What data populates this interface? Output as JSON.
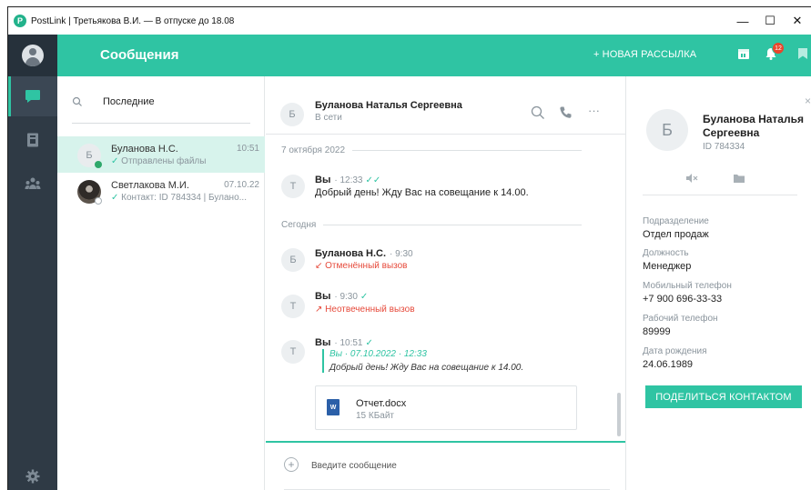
{
  "window": {
    "title": "PostLink  |  Третьякова В.И.  —  В отпуске до 18.08",
    "app_logo": "P",
    "minimize": "—",
    "maximize": "☐",
    "close": "✕"
  },
  "header": {
    "title": "Сообщения",
    "new_mailing": "+ НОВАЯ РАССЫЛКА",
    "notifications_count": "12"
  },
  "search": {
    "label": "Последние"
  },
  "chats": [
    {
      "initial": "Б",
      "name": "Буланова Н.С.",
      "time": "10:51",
      "tick": "✓",
      "preview": "Отправлены файлы",
      "status_color": "#2fa86b"
    },
    {
      "initial": "",
      "name": "Светлакова М.И.",
      "time": "07.10.22",
      "tick": "✓",
      "preview": "Контакт: ID 784334 | Булано...",
      "status_color": "#ffffff"
    }
  ],
  "conversation": {
    "initial": "Б",
    "name": "Буланова Наталья Сергеевна",
    "status": "В сети",
    "more": "···",
    "date1": "7 октября 2022",
    "date2": "Сегодня",
    "messages": [
      {
        "initial": "Т",
        "author": "Вы",
        "time": "· 12:33",
        "tick": "✓✓",
        "text": "Добрый день! Жду Вас на совещание к 14.00."
      },
      {
        "initial": "Б",
        "author": "Буланова Н.С.",
        "time": "· 9:30",
        "text": "↙ Отменённый вызов"
      },
      {
        "initial": "Т",
        "author": "Вы",
        "time": "· 9:30",
        "tick": "✓",
        "text": "↗ Неотвеченный вызов"
      },
      {
        "initial": "Т",
        "author": "Вы",
        "time": "· 10:51",
        "tick": "✓",
        "quote_head": "Вы · 07.10.2022 · 12:33",
        "quote_text": "Добрый день! Жду Вас на совещание к 14.00."
      }
    ],
    "file": {
      "icon_label": "W",
      "name": "Отчет.docx",
      "size": "15 КБайт"
    },
    "compose_placeholder": "Введите сообщение",
    "compose_plus": "+"
  },
  "details": {
    "close": "×",
    "initial": "Б",
    "name": "Буланова Наталья Сергеевна",
    "id": "ID 784334",
    "fields": [
      {
        "label": "Подразделение",
        "value": "Отдел продаж"
      },
      {
        "label": "Должность",
        "value": "Менеджер"
      },
      {
        "label": "Мобильный телефон",
        "value": "+7 900 696-33-33"
      },
      {
        "label": "Рабочий телефон",
        "value": "89999"
      },
      {
        "label": "Дата рождения",
        "value": "24.06.1989"
      }
    ],
    "share_button": "ПОДЕЛИТЬСЯ КОНТАКТОМ"
  },
  "colors": {
    "accent": "#2fc4a3",
    "rail": "#2f3a45",
    "missed_call": "#e64a3b",
    "badge": "#e8452c"
  },
  "icons": {
    "rail": [
      "chat-icon",
      "contacts-book-icon",
      "group-icon",
      "settings-gear-icon"
    ],
    "header": [
      "calendar-icon",
      "bell-icon",
      "bookmark-icon"
    ],
    "conversation": [
      "search-icon",
      "phone-icon",
      "more-icon"
    ],
    "details": [
      "mute-icon",
      "folder-icon"
    ]
  }
}
